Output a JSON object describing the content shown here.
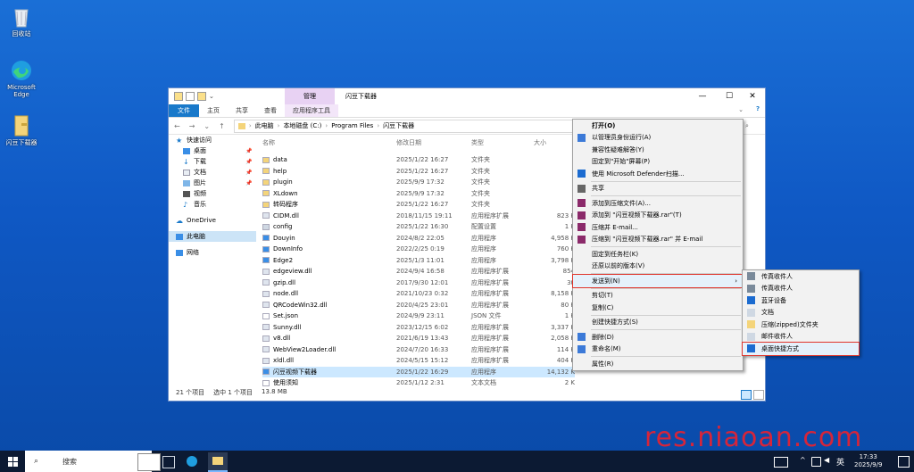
{
  "desktop": {
    "icons": [
      {
        "label": "回收站",
        "icon": "recycle-bin-icon"
      },
      {
        "label": "Microsoft Edge",
        "icon": "edge-icon"
      },
      {
        "label": "闪豆下载器",
        "icon": "folder-icon"
      }
    ]
  },
  "window": {
    "context_tab_header": "管理",
    "title": "闪豆下载器",
    "controls": {
      "minimize": "—",
      "maximize": "☐",
      "close": "✕"
    },
    "ribbon_tabs": [
      "文件",
      "主页",
      "共享",
      "查看",
      "应用程序工具"
    ],
    "address": {
      "back": "←",
      "forward": "→",
      "recent": "⌄",
      "up": "↑",
      "crumbs": [
        "此电脑",
        "本地磁盘 (C:)",
        "Program Files",
        "闪豆下载器"
      ],
      "refresh": "⟳"
    },
    "sidebar": [
      {
        "label": "快速访问",
        "icon": "star-icon",
        "pinned": false
      },
      {
        "label": "桌面",
        "icon": "desktop-icon",
        "pinned": true
      },
      {
        "label": "下载",
        "icon": "download-icon",
        "pinned": true
      },
      {
        "label": "文档",
        "icon": "document-icon",
        "pinned": true
      },
      {
        "label": "图片",
        "icon": "picture-icon",
        "pinned": true
      },
      {
        "label": "视频",
        "icon": "video-icon",
        "pinned": false
      },
      {
        "label": "音乐",
        "icon": "music-icon",
        "pinned": false
      },
      {
        "label": "OneDrive",
        "icon": "cloud-icon",
        "pinned": false
      },
      {
        "label": "此电脑",
        "icon": "computer-icon",
        "pinned": false
      },
      {
        "label": "网络",
        "icon": "network-icon",
        "pinned": false
      }
    ],
    "columns": {
      "name": "名称",
      "date": "修改日期",
      "type": "类型",
      "size": "大小"
    },
    "files": [
      {
        "name": "data",
        "date": "2025/1/22 16:27",
        "type": "文件夹",
        "size": "",
        "kind": "folder"
      },
      {
        "name": "help",
        "date": "2025/1/22 16:27",
        "type": "文件夹",
        "size": "",
        "kind": "folder"
      },
      {
        "name": "plugin",
        "date": "2025/9/9 17:32",
        "type": "文件夹",
        "size": "",
        "kind": "folder"
      },
      {
        "name": "XLdown",
        "date": "2025/9/9 17:32",
        "type": "文件夹",
        "size": "",
        "kind": "folder"
      },
      {
        "name": "转码程序",
        "date": "2025/1/22 16:27",
        "type": "文件夹",
        "size": "",
        "kind": "folder"
      },
      {
        "name": "CIDM.dll",
        "date": "2018/11/15 19:11",
        "type": "应用程序扩展",
        "size": "823 K",
        "kind": "dll"
      },
      {
        "name": "config",
        "date": "2025/1/22 16:30",
        "type": "配置设置",
        "size": "1 K",
        "kind": "config"
      },
      {
        "name": "Douyin",
        "date": "2024/8/2 22:05",
        "type": "应用程序",
        "size": "4,958 K",
        "kind": "app"
      },
      {
        "name": "DownInfo",
        "date": "2022/2/25 0:19",
        "type": "应用程序",
        "size": "760 K",
        "kind": "app"
      },
      {
        "name": "Edge2",
        "date": "2025/1/3 11:01",
        "type": "应用程序",
        "size": "3,798 K",
        "kind": "app"
      },
      {
        "name": "edgeview.dll",
        "date": "2024/9/4 16:58",
        "type": "应用程序扩展",
        "size": "854",
        "kind": "dll"
      },
      {
        "name": "gzip.dll",
        "date": "2017/9/30 12:01",
        "type": "应用程序扩展",
        "size": "30",
        "kind": "dll"
      },
      {
        "name": "node.dll",
        "date": "2021/10/23 0:32",
        "type": "应用程序扩展",
        "size": "8,158 K",
        "kind": "dll"
      },
      {
        "name": "QRCodeWin32.dll",
        "date": "2020/4/25 23:01",
        "type": "应用程序扩展",
        "size": "80 K",
        "kind": "dll"
      },
      {
        "name": "Set.json",
        "date": "2024/9/9 23:11",
        "type": "JSON 文件",
        "size": "1 K",
        "kind": "file"
      },
      {
        "name": "Sunny.dll",
        "date": "2023/12/15 6:02",
        "type": "应用程序扩展",
        "size": "3,337 K",
        "kind": "dll"
      },
      {
        "name": "v8.dll",
        "date": "2021/6/19 13:43",
        "type": "应用程序扩展",
        "size": "2,058 K",
        "kind": "dll"
      },
      {
        "name": "WebView2Loader.dll",
        "date": "2024/7/20 16:33",
        "type": "应用程序扩展",
        "size": "114 K",
        "kind": "dll"
      },
      {
        "name": "xldl.dll",
        "date": "2024/5/15 15:12",
        "type": "应用程序扩展",
        "size": "404 K",
        "kind": "dll"
      },
      {
        "name": "闪豆视频下载器",
        "date": "2025/1/22 16:29",
        "type": "应用程序",
        "size": "14,132 K",
        "kind": "app",
        "selected": true
      },
      {
        "name": "使用须知",
        "date": "2025/1/12 2:31",
        "type": "文本文档",
        "size": "2 K",
        "kind": "file"
      }
    ],
    "status": {
      "count": "21 个项目",
      "selected": "选中 1 个项目",
      "size": "13.8 MB"
    }
  },
  "context_menu": {
    "items": [
      {
        "label": "打开(O)",
        "bold": true,
        "icon": ""
      },
      {
        "label": "以管理员身份运行(A)",
        "icon": "shield-icon"
      },
      {
        "label": "兼容性疑难解答(Y)",
        "icon": ""
      },
      {
        "label": "固定到\"开始\"屏幕(P)",
        "icon": ""
      },
      {
        "label": "使用 Microsoft Defender扫描...",
        "icon": "defender-icon"
      },
      {
        "label": "共享",
        "icon": "share-icon"
      },
      {
        "label": "添加到压缩文件(A)...",
        "icon": "winrar-icon"
      },
      {
        "label": "添加到 \"闪豆视频下载器.rar\"(T)",
        "icon": "winrar-icon"
      },
      {
        "label": "压缩并 E-mail...",
        "icon": "winrar-icon"
      },
      {
        "label": "压缩到 \"闪豆视频下载器.rar\" 并 E-mail",
        "icon": "winrar-icon"
      },
      {
        "label": "固定到任务栏(K)",
        "icon": ""
      },
      {
        "label": "还原以前的版本(V)",
        "icon": ""
      },
      {
        "label": "发送到(N)",
        "icon": "",
        "highlight": true,
        "submenu": true
      },
      {
        "label": "剪切(T)",
        "icon": ""
      },
      {
        "label": "复制(C)",
        "icon": ""
      },
      {
        "label": "创建快捷方式(S)",
        "icon": ""
      },
      {
        "label": "删除(D)",
        "icon": "shield-icon"
      },
      {
        "label": "重命名(M)",
        "icon": "shield-icon"
      },
      {
        "label": "属性(R)",
        "icon": ""
      }
    ],
    "submenu_arrow": "›"
  },
  "send_to_menu": {
    "items": [
      {
        "label": "传真收件人",
        "icon": "fax-icon"
      },
      {
        "label": "传真收件人",
        "icon": "fax-icon"
      },
      {
        "label": "蓝牙设备",
        "icon": "bluetooth-icon"
      },
      {
        "label": "文档",
        "icon": "document-icon"
      },
      {
        "label": "压缩(zipped)文件夹",
        "icon": "zip-folder-icon"
      },
      {
        "label": "邮件收件人",
        "icon": "mail-icon"
      },
      {
        "label": "桌面快捷方式",
        "icon": "desktop-icon",
        "highlight": true
      }
    ]
  },
  "taskbar": {
    "search_placeholder": "搜索",
    "ime": "英",
    "time": "17:33",
    "date": "2025/9/9",
    "tray_chevron": "^"
  },
  "watermark": "res.niaoan.com",
  "colors": {
    "accent": "#1979ca",
    "selection": "#cce8ff",
    "highlight_border": "#e0342a",
    "desktop": "#0f58c4",
    "watermark": "#d6253a"
  }
}
